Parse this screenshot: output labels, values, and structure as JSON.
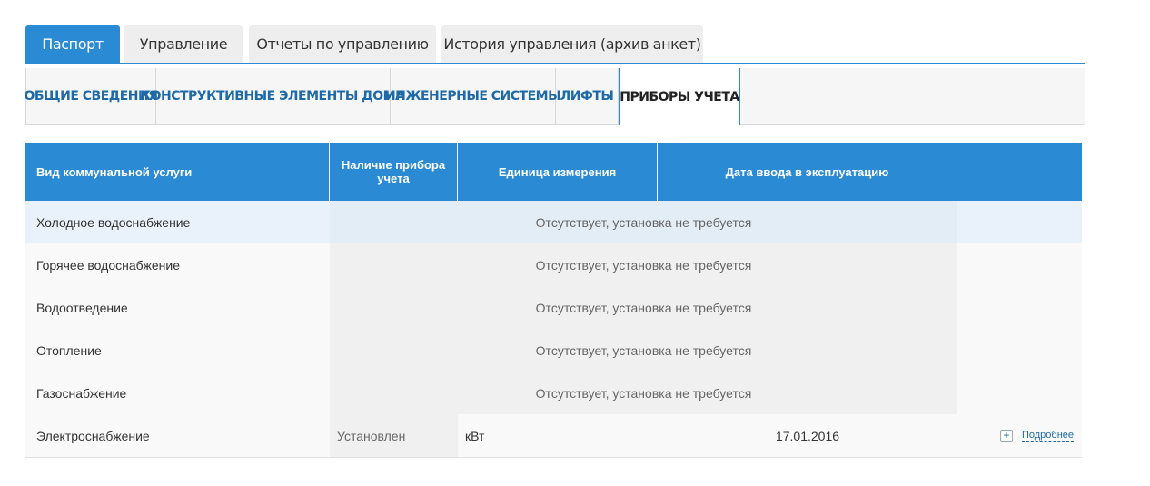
{
  "top_tabs": [
    {
      "label": "Паспорт",
      "active": true
    },
    {
      "label": "Управление",
      "active": false
    },
    {
      "label": "Отчеты по управлению",
      "active": false
    },
    {
      "label": "История управления (архив анкет)",
      "active": false
    }
  ],
  "sub_tabs": [
    {
      "label": "ОБЩИЕ СВЕДЕНИЯ",
      "active": false
    },
    {
      "label": "КОНСТРУКТИВНЫЕ ЭЛЕМЕНТЫ ДОМА",
      "active": false
    },
    {
      "label": "ИНЖЕНЕРНЫЕ СИСТЕМЫ",
      "active": false
    },
    {
      "label": "ЛИФТЫ",
      "active": false
    },
    {
      "label": "ПРИБОРЫ УЧЕТА",
      "active": true
    }
  ],
  "table": {
    "headers": [
      "Вид коммунальной услуги",
      "Наличие прибора учета",
      "Единица измерения",
      "Дата ввода в эксплуатацию",
      ""
    ],
    "rows": [
      {
        "service": "Холодное водоснабжение",
        "status": "Отсутствует, установка не требуется"
      },
      {
        "service": "Горячее водоснабжение",
        "status": "Отсутствует, установка не требуется"
      },
      {
        "service": "Водоотведение",
        "status": "Отсутствует, установка не требуется"
      },
      {
        "service": "Отопление",
        "status": "Отсутствует, установка не требуется"
      },
      {
        "service": "Газоснабжение",
        "status": "Отсутствует, установка не требуется"
      },
      {
        "service": "Электроснабжение",
        "presence": "Установлен",
        "unit": "кВт",
        "date": "17.01.2016",
        "more_label": "Подробнее",
        "more_icon": "plus-icon"
      }
    ]
  },
  "colors": {
    "accent": "#2a8bd4",
    "link": "#1e6aa8",
    "highlight_row": "#e9f2fa"
  }
}
